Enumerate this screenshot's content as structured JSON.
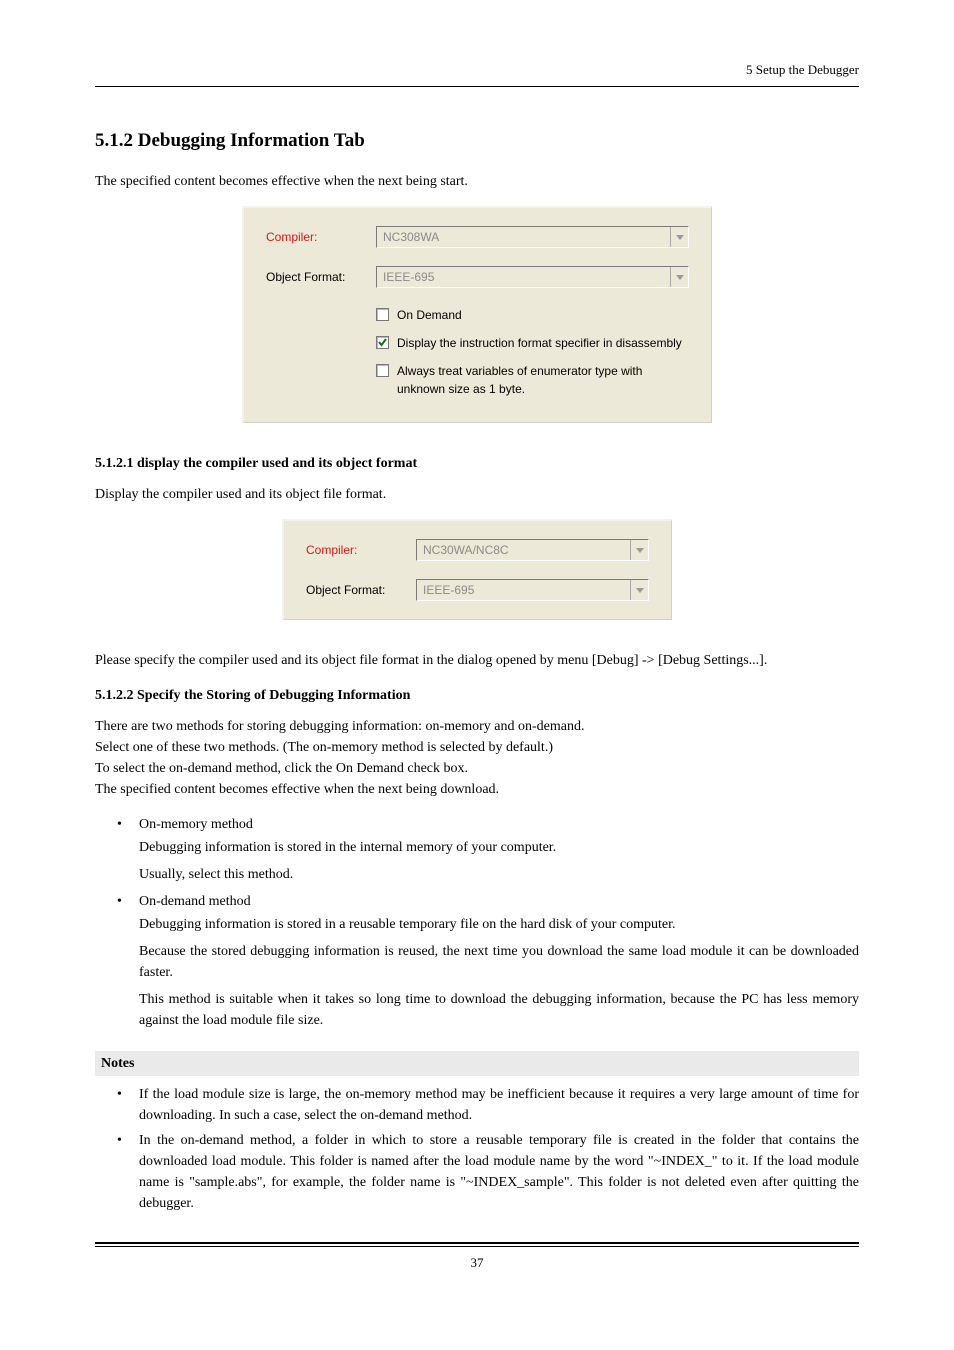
{
  "header": {
    "right": "5 Setup the Debugger"
  },
  "h512": {
    "title": "5.1.2 Debugging Information Tab",
    "intro": "The specified content becomes effective when the next being start."
  },
  "panel1": {
    "compiler_label": "Compiler:",
    "compiler_value": "NC308WA",
    "objfmt_label": "Object Format:",
    "objfmt_value": "IEEE-695",
    "chk1": "On Demand",
    "chk2": "Display the instruction format specifier in disassembly",
    "chk3": "Always treat variables of enumerator type with unknown size as 1 byte."
  },
  "h51221": {
    "title": "5.1.2.1 display the compiler used and its object format",
    "p1": "Display the compiler used and its object file format."
  },
  "panel2": {
    "compiler_label": "Compiler:",
    "compiler_value": "NC30WA/NC8C",
    "objfmt_label": "Object Format:",
    "objfmt_value": "IEEE-695"
  },
  "para1": "Please specify the compiler used and its object file format in the dialog opened by menu [Debug] -> [Debug Settings...].",
  "h51222": {
    "title": "5.1.2.2 Specify the Storing of Debugging Information",
    "p1": "There are two methods for storing debugging information: on-memory and on-demand.",
    "p2": "Select one of these two methods. (The on-memory method is selected by default.)",
    "p3": "To select the on-demand method, click the On Demand check box.",
    "p4": "The specified content becomes effective when the next being download."
  },
  "list1": {
    "i1": "On-memory method",
    "i1a": "Debugging information is stored in the internal memory of your computer.",
    "i1b": "Usually, select this method.",
    "i2": "On-demand method",
    "i2a": "Debugging information is stored in a reusable temporary file on the hard disk of your computer.",
    "i2b": "Because the stored debugging information is reused, the next time you download the same load module it can be downloaded faster.",
    "i2c": "This method is suitable when it takes so long time to download the debugging information, because the PC has less memory against the load module file size."
  },
  "notes": {
    "title": "Notes",
    "n1": "If the load module size is large, the on-memory method may be inefficient because it requires a very large amount of time for downloading. In such a case, select the on-demand method.",
    "n2": "In the on-demand method, a folder in which to store a reusable temporary file is created in the folder that contains the downloaded load module. This folder is named after the load module name by the word \"~INDEX_\" to it. If the load module name is \"sample.abs\", for example, the folder name is \"~INDEX_sample\". This folder is not deleted even after quitting the debugger."
  },
  "page": "37"
}
